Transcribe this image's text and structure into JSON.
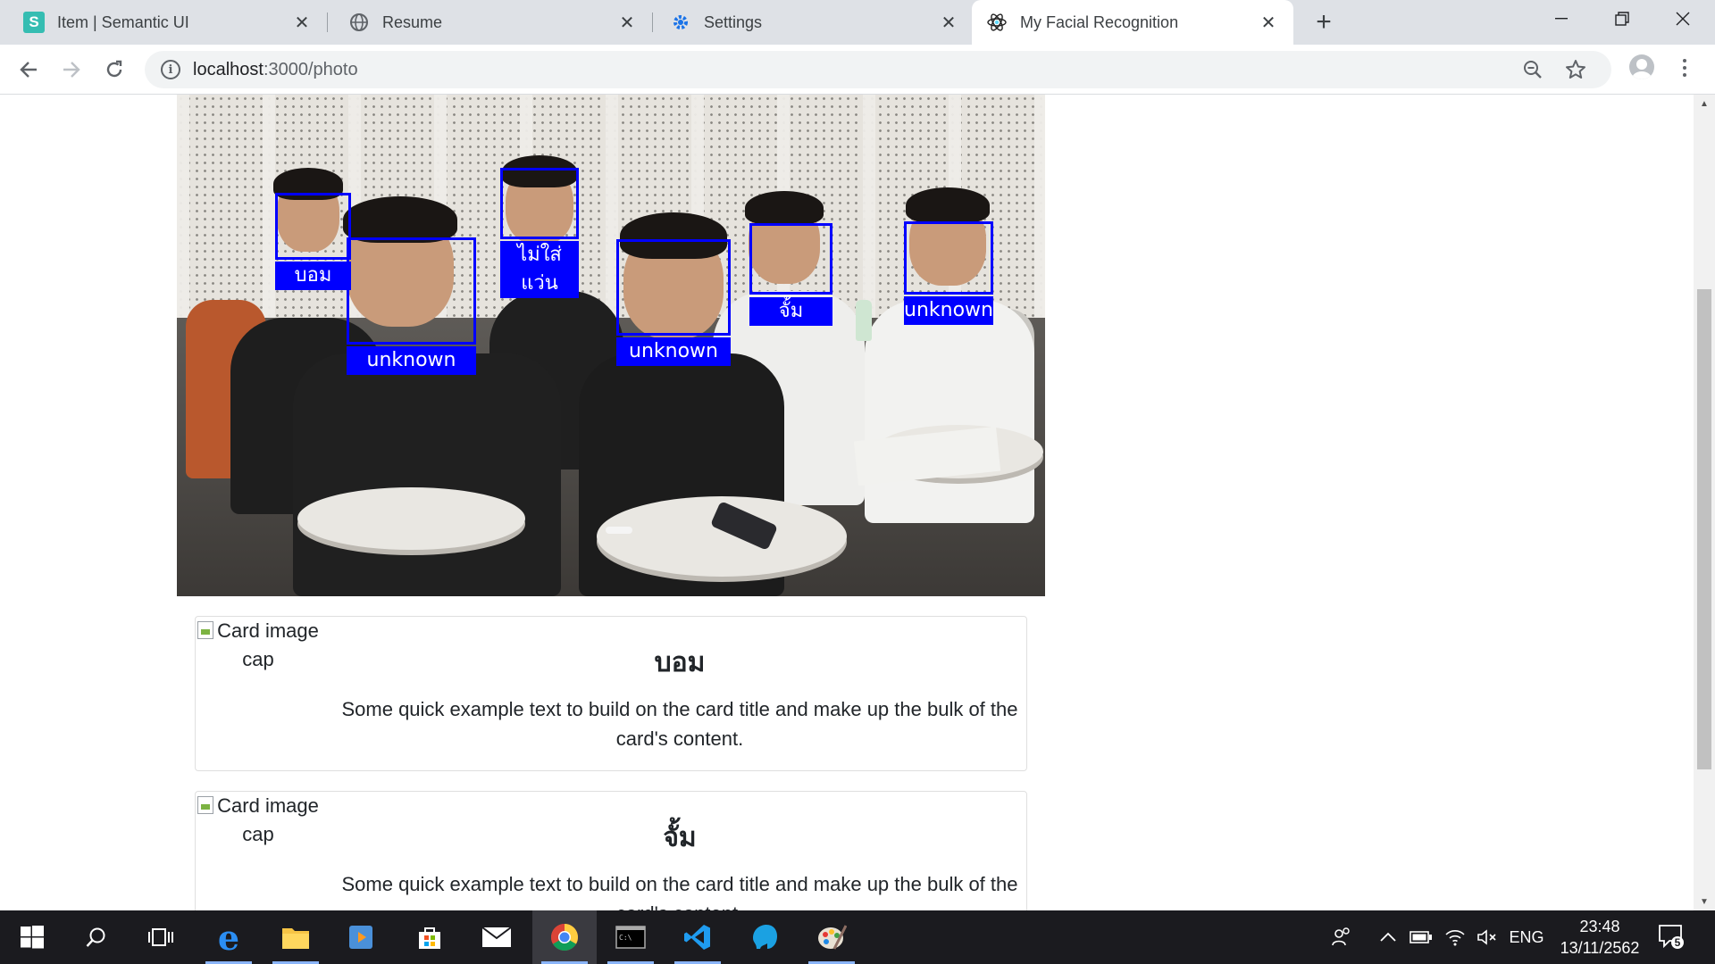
{
  "browser": {
    "tabs": [
      {
        "title": "Item | Semantic UI",
        "favicon": "semantic-ui-icon"
      },
      {
        "title": "Resume",
        "favicon": "globe-icon"
      },
      {
        "title": "Settings",
        "favicon": "gear-icon"
      },
      {
        "title": "My Facial Recognition",
        "favicon": "react-icon",
        "active": true
      }
    ],
    "address": {
      "host": "localhost",
      "path": ":3000/photo"
    }
  },
  "photo": {
    "faces": [
      {
        "label": "บอม"
      },
      {
        "label": "unknown"
      },
      {
        "label": "ไม่ใส่แว่น"
      },
      {
        "label": "unknown"
      },
      {
        "label": "จั้ม"
      },
      {
        "label": "unknown"
      }
    ]
  },
  "cards": [
    {
      "image_alt": "Card image cap",
      "title": "บอม",
      "text": "Some quick example text to build on the card title and make up the bulk of the card's content."
    },
    {
      "image_alt": "Card image cap",
      "title": "จั้ม",
      "text": "Some quick example text to build on the card title and make up the bulk of the card's content."
    }
  ],
  "taskbar": {
    "apps": [
      "start-icon",
      "search-icon",
      "task-view-icon",
      "edge-icon",
      "file-explorer-icon",
      "media-player-icon",
      "store-icon",
      "mail-icon",
      "chrome-icon",
      "terminal-icon",
      "vscode-icon",
      "mysql-workbench-icon",
      "paint-icon"
    ],
    "language": "ENG",
    "time": "23:48",
    "date": "13/11/2562",
    "notifications": "5"
  },
  "colors": {
    "face_box": "#0000ff",
    "tabstrip": "#dee1e6",
    "taskbar": "#1b1b1f"
  }
}
